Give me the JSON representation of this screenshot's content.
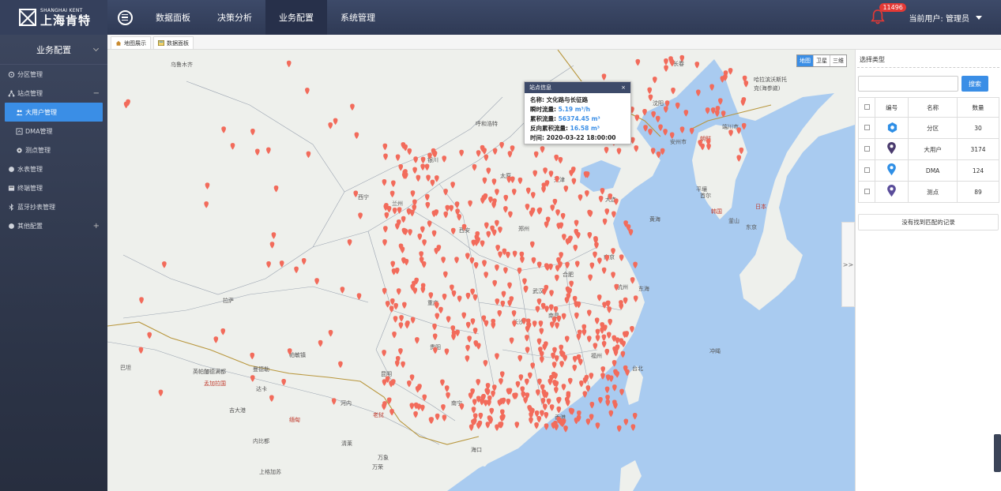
{
  "brand": {
    "en": "SHANGHAI KENT",
    "cn": "上海肯特"
  },
  "nav": [
    {
      "label": "数据面板",
      "active": false
    },
    {
      "label": "决策分析",
      "active": false
    },
    {
      "label": "业务配置",
      "active": true
    },
    {
      "label": "系统管理",
      "active": false
    }
  ],
  "alerts": {
    "count": "11496"
  },
  "user": {
    "label": "当前用户: 管理员"
  },
  "sidebar": {
    "title": "业务配置",
    "items": [
      {
        "label": "分区管理",
        "icon": "partition-icon",
        "sub": false,
        "active": false,
        "pm": ""
      },
      {
        "label": "站点管理",
        "icon": "site-tree-icon",
        "sub": false,
        "active": false,
        "pm": "−"
      },
      {
        "label": "大用户管理",
        "icon": "users-icon",
        "sub": true,
        "active": true,
        "pm": ""
      },
      {
        "label": "DMA管理",
        "icon": "dma-icon",
        "sub": true,
        "active": false,
        "pm": ""
      },
      {
        "label": "测点管理",
        "icon": "point-icon",
        "sub": true,
        "active": false,
        "pm": ""
      },
      {
        "label": "水表管理",
        "icon": "meter-icon",
        "sub": false,
        "active": false,
        "pm": ""
      },
      {
        "label": "终端管理",
        "icon": "terminal-icon",
        "sub": false,
        "active": false,
        "pm": ""
      },
      {
        "label": "蓝牙抄表管理",
        "icon": "bluetooth-icon",
        "sub": false,
        "active": false,
        "pm": ""
      },
      {
        "label": "其他配置",
        "icon": "other-icon",
        "sub": false,
        "active": false,
        "pm": "+"
      }
    ]
  },
  "tabs": [
    {
      "label": "地图展示",
      "icon": "home-icon"
    },
    {
      "label": "数据面板",
      "icon": "panel-icon"
    }
  ],
  "map": {
    "types": [
      {
        "label": "地图",
        "active": true
      },
      {
        "label": "卫星",
        "active": false
      },
      {
        "label": "三维",
        "active": false
      }
    ],
    "collapse": ">>",
    "places": [
      {
        "t": "乌鲁木齐"
      },
      {
        "t": "呼和浩特"
      },
      {
        "t": "长春"
      },
      {
        "t": "哈拉滨沃斯托"
      },
      {
        "t": "克(海参崴)"
      },
      {
        "t": "沈阳"
      },
      {
        "t": "安州市"
      },
      {
        "t": "朝鲜"
      },
      {
        "t": "端川市"
      },
      {
        "t": "平壤"
      },
      {
        "t": "天津"
      },
      {
        "t": "银川"
      },
      {
        "t": "太原"
      },
      {
        "t": "西宁"
      },
      {
        "t": "兰州"
      },
      {
        "t": "西安"
      },
      {
        "t": "郑州"
      },
      {
        "t": "合肥"
      },
      {
        "t": "南京"
      },
      {
        "t": "武汉"
      },
      {
        "t": "拉萨"
      },
      {
        "t": "重庆"
      },
      {
        "t": "长沙"
      },
      {
        "t": "南昌"
      },
      {
        "t": "贵阳"
      },
      {
        "t": "昆明"
      },
      {
        "t": "南宁"
      },
      {
        "t": "香港"
      },
      {
        "t": "海口"
      },
      {
        "t": "台北"
      },
      {
        "t": "福州"
      },
      {
        "t": "杭州"
      },
      {
        "t": "首尔"
      },
      {
        "t": "韩国"
      },
      {
        "t": "釜山"
      },
      {
        "t": "日本"
      },
      {
        "t": "东京"
      },
      {
        "t": "冲绳"
      },
      {
        "t": "黄海"
      },
      {
        "t": "东海"
      },
      {
        "t": "加德满都"
      },
      {
        "t": "孟加拉国"
      },
      {
        "t": "缅甸"
      },
      {
        "t": "河内"
      },
      {
        "t": "老挝"
      },
      {
        "t": "清莱"
      },
      {
        "t": "万象"
      },
      {
        "t": "内比都"
      },
      {
        "t": "万荣"
      },
      {
        "t": "英帕尔"
      },
      {
        "t": "吉大港"
      },
      {
        "t": "达卡"
      },
      {
        "t": "曼德勒"
      },
      {
        "t": "帕敏镇"
      },
      {
        "t": "上格加苏"
      },
      {
        "t": "巴坦"
      },
      {
        "t": "大连"
      }
    ],
    "marker_color": "#f26b5b",
    "popup": {
      "title": "站点信息",
      "close": "×",
      "name_label": "名称:",
      "name_value": "文化路与长征路",
      "flow_label": "瞬时流量:",
      "flow_value": "5.19 m³/h",
      "cum_label": "累积流量:",
      "cum_value": "56374.45 m³",
      "rev_label": "反向累积流量:",
      "rev_value": "16.58 m³",
      "time_label": "时间:",
      "time_value": "2020-03-22 18:00:00"
    }
  },
  "panel": {
    "title": "选择类型",
    "search_button": "搜索",
    "headers": {
      "id": "编号",
      "name": "名称",
      "count": "数量"
    },
    "rows": [
      {
        "icon": "partition-legend-icon",
        "color": "#2f8fe6",
        "name": "分区",
        "count": "30"
      },
      {
        "icon": "big-user-legend-icon",
        "color": "#4a3b6e",
        "name": "大用户",
        "count": "3174"
      },
      {
        "icon": "dma-legend-icon",
        "color": "#2f8fe6",
        "name": "DMA",
        "count": "124"
      },
      {
        "icon": "point-legend-icon",
        "color": "#5a4d9a",
        "name": "测点",
        "count": "89"
      }
    ],
    "no_record": "没有找到匹配的记录"
  }
}
